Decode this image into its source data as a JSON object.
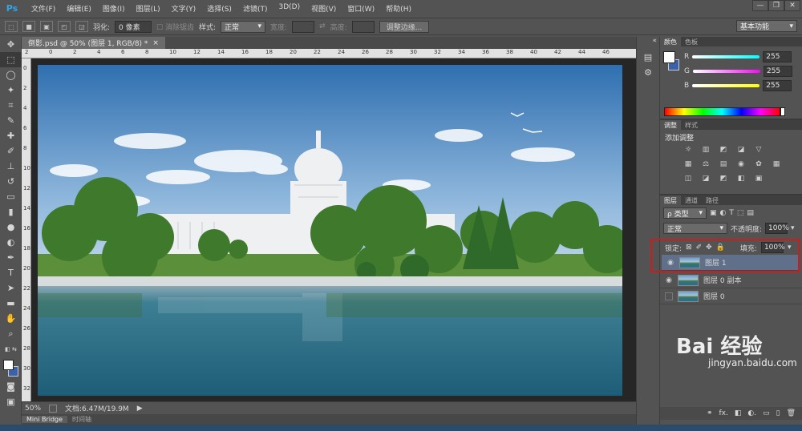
{
  "app": {
    "logo": "Ps"
  },
  "menu": [
    "文件(F)",
    "编辑(E)",
    "图像(I)",
    "图层(L)",
    "文字(Y)",
    "选择(S)",
    "滤镜(T)",
    "3D(D)",
    "视图(V)",
    "窗口(W)",
    "帮助(H)"
  ],
  "window_controls": [
    "—",
    "❐",
    "✕"
  ],
  "options": {
    "feather_label": "羽化:",
    "feather_value": "0 像素",
    "antialias_label": "消除锯齿",
    "style_label": "样式:",
    "style_value": "正常",
    "width_label": "宽度:",
    "height_label": "高度:",
    "refine_button": "调整边缘...",
    "workspace": "基本功能"
  },
  "document": {
    "tab_title": "倒影.psd @ 50% (图层 1, RGB/8) *",
    "close": "×",
    "zoom": "50%",
    "doc_size": "文档:6.47M/19.9M"
  },
  "ruler_top": [
    "2",
    "0",
    "2",
    "4",
    "6",
    "8",
    "10",
    "12",
    "14",
    "16",
    "18",
    "20",
    "22",
    "24",
    "26",
    "28",
    "30",
    "32",
    "34",
    "36",
    "38",
    "40",
    "42",
    "44",
    "46"
  ],
  "ruler_left": [
    "0",
    "2",
    "4",
    "6",
    "8",
    "10",
    "12",
    "14",
    "16",
    "18",
    "20",
    "22",
    "24",
    "26",
    "28",
    "30",
    "32"
  ],
  "bottom_tabs": [
    "Mini Bridge",
    "时间轴"
  ],
  "color_panel": {
    "tabs": [
      "颜色",
      "色板"
    ],
    "channels": [
      {
        "name": "R",
        "value": "255",
        "gradient": "#00ffff"
      },
      {
        "name": "G",
        "value": "255",
        "gradient": "#ff00ff"
      },
      {
        "name": "B",
        "value": "255",
        "gradient": "#ffff00"
      }
    ]
  },
  "adjust_panel": {
    "tabs": [
      "调整",
      "样式"
    ],
    "title": "添加调整",
    "row1": [
      "☼",
      "▥",
      "◩",
      "◪",
      "▽"
    ],
    "row2": [
      "▦",
      "⚖",
      "▤",
      "◉",
      "✿",
      "▦"
    ],
    "row3": [
      "◫",
      "◪",
      "◩",
      "◧",
      "▣"
    ]
  },
  "layers_panel": {
    "tabs": [
      "图层",
      "通道",
      "路径"
    ],
    "filter_label": "ρ 类型",
    "blend_mode": "正常",
    "opacity_label": "不透明度:",
    "opacity_value": "100%",
    "lock_label": "锁定:",
    "fill_label": "填充:",
    "fill_value": "100%",
    "layers": [
      {
        "name": "图层 1",
        "visible": true,
        "selected": true
      },
      {
        "name": "图层 0 副本",
        "visible": true,
        "selected": false
      },
      {
        "name": "图层 0",
        "visible": false,
        "selected": false
      }
    ],
    "footer_icons": [
      "⚭",
      "fx.",
      "◧",
      "◐.",
      "▭",
      "▯",
      "🗑"
    ]
  },
  "watermark": {
    "brand": "Bai 经验",
    "url": "jingyan.baidu.com"
  }
}
